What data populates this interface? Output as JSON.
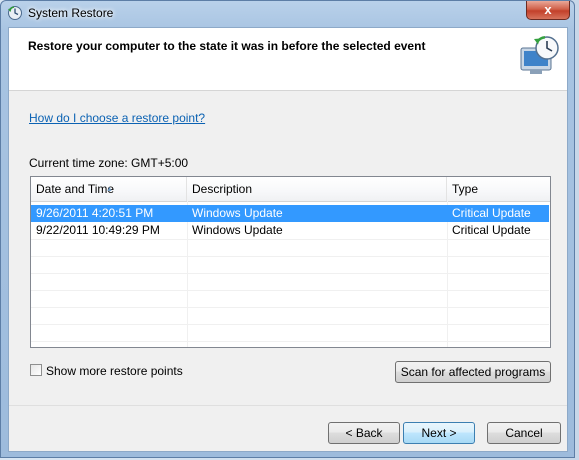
{
  "window": {
    "title": "System Restore",
    "close_label": "x"
  },
  "header": {
    "title": "Restore your computer to the state it was in before the selected event"
  },
  "help_link": "How do I choose a restore point?",
  "timezone": "Current time zone: GMT+5:00",
  "table": {
    "columns": [
      "Date and Time",
      "Description",
      "Type"
    ],
    "rows": [
      {
        "date": "9/26/2011 4:20:51 PM",
        "description": "Windows Update",
        "type": "Critical Update",
        "selected": true
      },
      {
        "date": "9/22/2011 10:49:29 PM",
        "description": "Windows Update",
        "type": "Critical Update",
        "selected": false
      }
    ]
  },
  "show_more_label": "Show more restore points",
  "buttons": {
    "scan": "Scan for affected programs",
    "back": "< Back",
    "next": "Next >",
    "cancel": "Cancel"
  },
  "colors": {
    "selection": "#3399ff",
    "link": "#0b62b3"
  }
}
